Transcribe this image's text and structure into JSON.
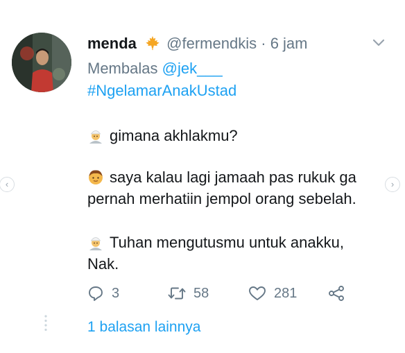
{
  "tweet": {
    "display_name": "menda",
    "handle": "@fermendkis",
    "separator": "·",
    "time": "6 jam",
    "reply_prefix": "Membalas",
    "reply_to": "@jek___",
    "hashtag": "#NgelamarAnakUstad",
    "lines": [
      "gimana akhlakmu?",
      "saya kalau lagi jamaah pas rukuk ga",
      "pernah merhatiin jempol orang sebelah.",
      "Tuhan mengutusmu untuk anakku,",
      "Nak."
    ],
    "counts": {
      "replies": "3",
      "retweets": "58",
      "likes": "281"
    },
    "more_replies": "1 balasan lainnya"
  },
  "icons": {
    "badge": "maple-leaf-icon",
    "speaker_1": "man-with-white-cap-emoji",
    "speaker_2": "boy-emoji",
    "reply": "reply-icon",
    "retweet": "retweet-icon",
    "like": "heart-icon",
    "share": "share-icon",
    "menu": "chevron-down-icon"
  },
  "colors": {
    "accent": "#1da1f2",
    "muted": "#657786",
    "text": "#14171a",
    "leaf": "#f5a623"
  }
}
